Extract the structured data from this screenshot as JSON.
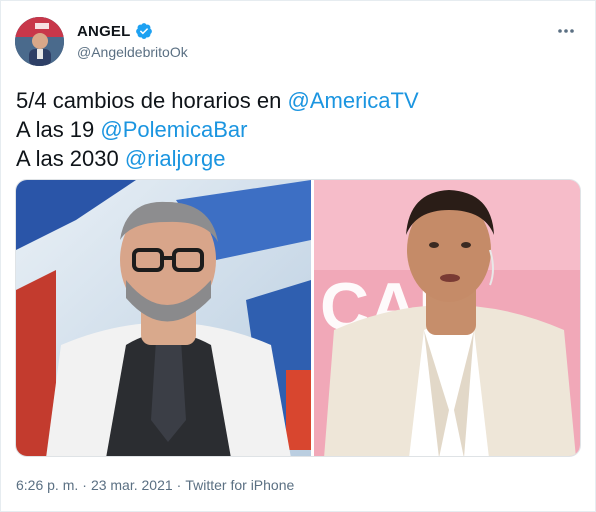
{
  "author": {
    "display_name": "ANGEL",
    "handle": "@AngeldebritoOk",
    "verified": true,
    "avatar_icon": "profile-photo"
  },
  "more_icon": "more-options-icon",
  "tweet": {
    "lines": [
      {
        "text": "5/4 cambios de horarios en ",
        "mention": "@AmericaTV"
      },
      {
        "text": "A las 19 ",
        "mention": "@PolemicaBar"
      },
      {
        "text": "A las 2030 ",
        "mention": "@rialjorge"
      }
    ]
  },
  "media": [
    {
      "description_icon": "photo-left"
    },
    {
      "description_icon": "photo-right",
      "sign_text": "CAM"
    }
  ],
  "meta": {
    "time": "6:26 p. m.",
    "separator": "·",
    "date": "23 mar. 2021",
    "source": "Twitter for iPhone"
  },
  "colors": {
    "mention": "#1b95e0",
    "verified": "#1da1f2",
    "secondary_text": "#5b7083"
  }
}
